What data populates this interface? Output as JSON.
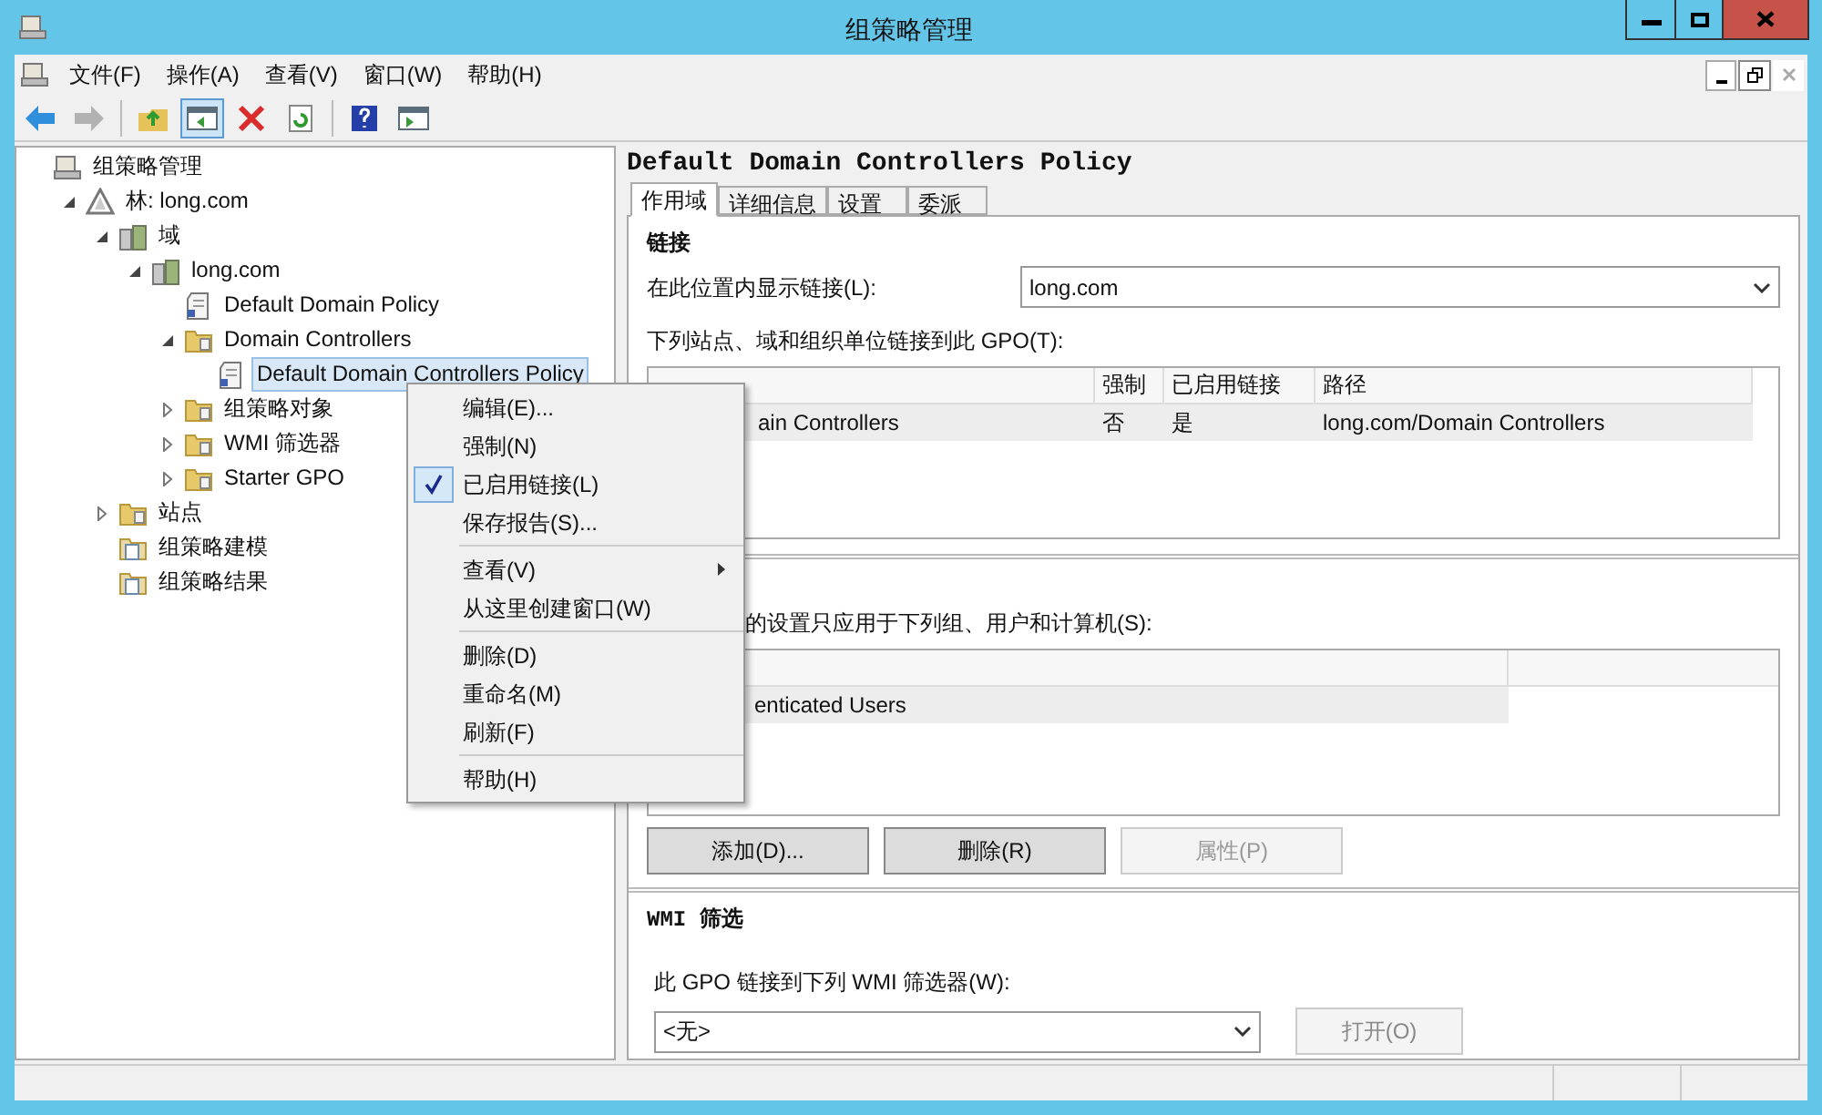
{
  "window": {
    "title": "组策略管理"
  },
  "menu_bar": [
    "文件(F)",
    "操作(A)",
    "查看(V)",
    "窗口(W)",
    "帮助(H)"
  ],
  "toolbar": [
    {
      "kind": "back",
      "pressed": false,
      "disabled": false
    },
    {
      "kind": "forward",
      "pressed": false,
      "disabled": true
    },
    {
      "kind": "up",
      "pressed": false,
      "disabled": false
    },
    {
      "kind": "tree",
      "pressed": true,
      "disabled": false
    },
    {
      "kind": "delete",
      "pressed": false,
      "disabled": false
    },
    {
      "kind": "refresh",
      "pressed": false,
      "disabled": false
    },
    {
      "kind": "help",
      "pressed": false,
      "disabled": false
    },
    {
      "kind": "pane",
      "pressed": false,
      "disabled": false
    }
  ],
  "tree": [
    {
      "label": "组策略管理",
      "kind": "root",
      "selected": false,
      "children": [
        {
          "label": "林: long.com",
          "kind": "forest",
          "expanded": true,
          "selected": false,
          "children": [
            {
              "label": "域",
              "kind": "domains",
              "expanded": true,
              "selected": false,
              "children": [
                {
                  "label": "long.com",
                  "kind": "domain",
                  "expanded": true,
                  "selected": false,
                  "children": [
                    {
                      "label": "Default Domain Policy",
                      "kind": "gpo",
                      "selected": false
                    },
                    {
                      "label": "Domain Controllers",
                      "kind": "ou",
                      "expanded": true,
                      "selected": false,
                      "children": [
                        {
                          "label": "Default Domain Controllers Policy",
                          "kind": "gpo",
                          "selected": true
                        }
                      ]
                    },
                    {
                      "label": "组策略对象",
                      "kind": "folder",
                      "expanded": false,
                      "selected": false
                    },
                    {
                      "label": "WMI 筛选器",
                      "kind": "folder",
                      "expanded": false,
                      "selected": false
                    },
                    {
                      "label": "Starter GPO",
                      "kind": "folder",
                      "expanded": false,
                      "selected": false
                    }
                  ]
                }
              ]
            },
            {
              "label": "站点",
              "kind": "sites",
              "expanded": false,
              "selected": false
            },
            {
              "label": "组策略建模",
              "kind": "modeling",
              "selected": false
            },
            {
              "label": "组策略结果",
              "kind": "results",
              "selected": false
            }
          ]
        }
      ]
    }
  ],
  "context_menu": [
    [
      {
        "label": "编辑(E)...",
        "checked": false,
        "submenu": false
      },
      {
        "label": "强制(N)",
        "checked": false,
        "submenu": false
      },
      {
        "label": "已启用链接(L)",
        "checked": true,
        "submenu": false
      },
      {
        "label": "保存报告(S)...",
        "checked": false,
        "submenu": false
      }
    ],
    [
      {
        "label": "查看(V)",
        "checked": false,
        "submenu": true
      },
      {
        "label": "从这里创建窗口(W)",
        "checked": false,
        "submenu": false
      }
    ],
    [
      {
        "label": "删除(D)",
        "checked": false,
        "submenu": false
      },
      {
        "label": "重命名(M)",
        "checked": false,
        "submenu": false
      },
      {
        "label": "刷新(F)",
        "checked": false,
        "submenu": false
      }
    ],
    [
      {
        "label": "帮助(H)",
        "checked": false,
        "submenu": false
      }
    ]
  ],
  "details": {
    "title": "Default Domain Controllers Policy",
    "tabs": [
      {
        "label": "作用域",
        "selected": true
      },
      {
        "label": "详细信息",
        "selected": false
      },
      {
        "label": "设置",
        "selected": false
      },
      {
        "label": "委派",
        "selected": false
      }
    ],
    "links": {
      "heading": "链接",
      "location_label": "在此位置内显示链接(L):",
      "location_value": "long.com",
      "list_label": "下列站点、域和组织单位链接到此 GPO(T):",
      "columns": [
        "",
        "强制",
        "已启用链接",
        "路径"
      ],
      "rows": [
        {
          "cells": [
            "ain Controllers",
            "否",
            "是",
            "long.com/Domain Controllers"
          ],
          "selected": true
        }
      ]
    },
    "security": {
      "label": "的设置只应用于下列组、用户和计算机(S):",
      "rows": [
        {
          "name": "enticated Users",
          "selected": true
        }
      ],
      "buttons": [
        {
          "label": "添加(D)...",
          "disabled": false
        },
        {
          "label": "删除(R)",
          "disabled": false
        },
        {
          "label": "属性(P)",
          "disabled": true
        }
      ]
    },
    "wmi": {
      "heading": "WMI 筛选",
      "label": "此 GPO 链接到下列 WMI 筛选器(W):",
      "value": "<无>",
      "button": {
        "label": "打开(O)",
        "disabled": true
      }
    }
  }
}
